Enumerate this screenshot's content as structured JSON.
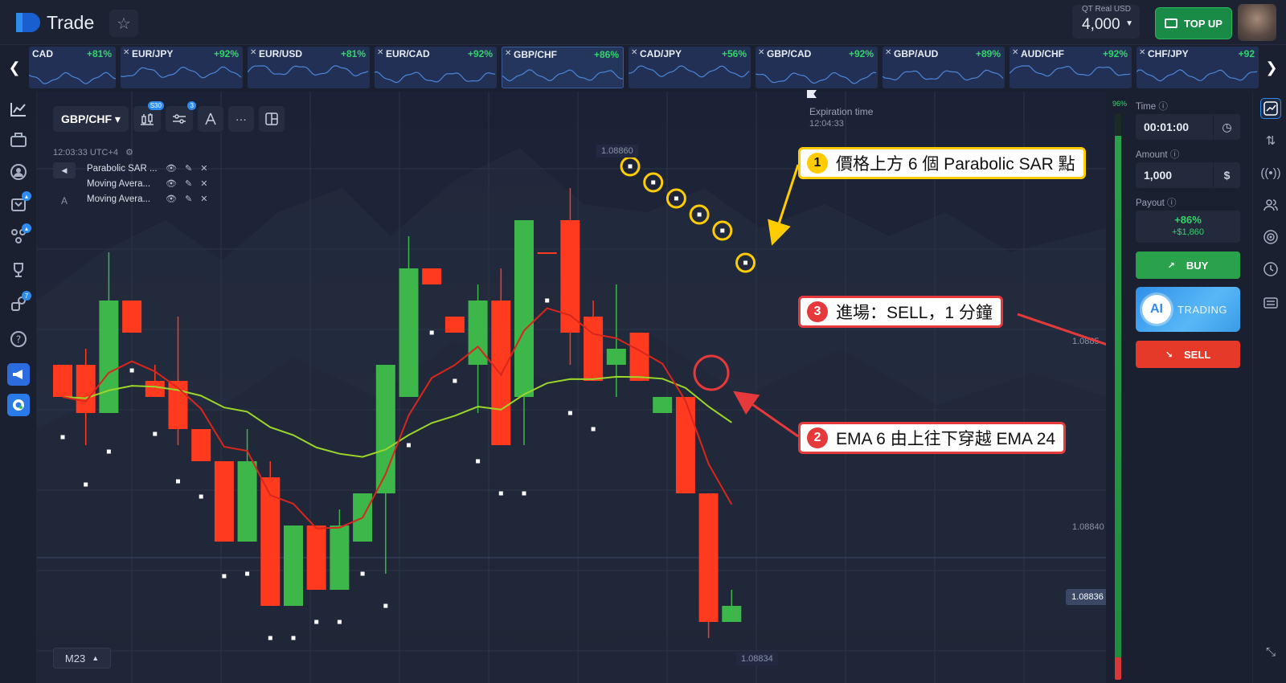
{
  "header": {
    "logo_text": "Trade",
    "account_label": "QT Real  USD",
    "account_value": "4,000",
    "topup_label": "TOP UP"
  },
  "pairs": [
    {
      "name": "CAD",
      "pct": "+81%"
    },
    {
      "name": "EUR/JPY",
      "pct": "+92%"
    },
    {
      "name": "EUR/USD",
      "pct": "+81%"
    },
    {
      "name": "EUR/CAD",
      "pct": "+92%"
    },
    {
      "name": "GBP/CHF",
      "pct": "+86%"
    },
    {
      "name": "CAD/JPY",
      "pct": "+56%"
    },
    {
      "name": "GBP/CAD",
      "pct": "+92%"
    },
    {
      "name": "GBP/AUD",
      "pct": "+89%"
    },
    {
      "name": "AUD/CHF",
      "pct": "+92%"
    },
    {
      "name": "CHF/JPY",
      "pct": "+92"
    }
  ],
  "sidebar_badges": {
    "bell": "",
    "gift": "",
    "group": "7"
  },
  "chart": {
    "pair": "GBP/CHF",
    "badge_candles": "S30",
    "badge_indicators": "3",
    "time_utc": "12:03:33 UTC+4",
    "indicators": [
      {
        "name": "Parabolic SAR ..."
      },
      {
        "name": "Moving Avera..."
      },
      {
        "name": "Moving Avera..."
      }
    ],
    "indicator_toggle_label": "A",
    "expiration_label": "Expiration time",
    "expiration_time": "12:04:33",
    "price_high": "1.08860",
    "price_mid": "1.0885",
    "price_low": "1.08840",
    "price_current": "1.08836",
    "price_min": "1.08834",
    "timeframe": "M23"
  },
  "chart_data": {
    "type": "candlestick",
    "candles": [
      {
        "dir": "down",
        "open": 1.08848,
        "close": 1.08846,
        "high": 1.08848,
        "low": 1.08846
      },
      {
        "dir": "down",
        "open": 1.08848,
        "close": 1.08845,
        "high": 1.08849,
        "low": 1.08843
      },
      {
        "dir": "up",
        "open": 1.08845,
        "close": 1.08852,
        "high": 1.08855,
        "low": 1.08845
      },
      {
        "dir": "down",
        "open": 1.08852,
        "close": 1.0885,
        "high": 1.08852,
        "low": 1.0885
      },
      {
        "dir": "down",
        "open": 1.08847,
        "close": 1.08846,
        "high": 1.08848,
        "low": 1.08846
      },
      {
        "dir": "down",
        "open": 1.08847,
        "close": 1.08844,
        "high": 1.08851,
        "low": 1.08843
      },
      {
        "dir": "down",
        "open": 1.08844,
        "close": 1.08842,
        "high": 1.08844,
        "low": 1.08842
      },
      {
        "dir": "down",
        "open": 1.08842,
        "close": 1.08837,
        "high": 1.08842,
        "low": 1.08837
      },
      {
        "dir": "up",
        "open": 1.08837,
        "close": 1.08842,
        "high": 1.08844,
        "low": 1.08837
      },
      {
        "dir": "down",
        "open": 1.08841,
        "close": 1.08833,
        "high": 1.08842,
        "low": 1.08833
      },
      {
        "dir": "up",
        "open": 1.08833,
        "close": 1.08838,
        "high": 1.08838,
        "low": 1.08833
      },
      {
        "dir": "down",
        "open": 1.08838,
        "close": 1.08834,
        "high": 1.08838,
        "low": 1.08834
      },
      {
        "dir": "up",
        "open": 1.08834,
        "close": 1.08838,
        "high": 1.08839,
        "low": 1.08834
      },
      {
        "dir": "up",
        "open": 1.08837,
        "close": 1.0884,
        "high": 1.0884,
        "low": 1.08837
      },
      {
        "dir": "up",
        "open": 1.0884,
        "close": 1.08848,
        "high": 1.08848,
        "low": 1.08835
      },
      {
        "dir": "up",
        "open": 1.08846,
        "close": 1.08854,
        "high": 1.08856,
        "low": 1.08846
      },
      {
        "dir": "down",
        "open": 1.08854,
        "close": 1.08853,
        "high": 1.08854,
        "low": 1.08853
      },
      {
        "dir": "down",
        "open": 1.08851,
        "close": 1.0885,
        "high": 1.08851,
        "low": 1.0885
      },
      {
        "dir": "up",
        "open": 1.08848,
        "close": 1.08852,
        "high": 1.08853,
        "low": 1.08845
      },
      {
        "dir": "down",
        "open": 1.08852,
        "close": 1.08843,
        "high": 1.08854,
        "low": 1.08843
      },
      {
        "dir": "up",
        "open": 1.08846,
        "close": 1.08857,
        "high": 1.08857,
        "low": 1.08843
      },
      {
        "dir": "down",
        "open": 1.08855,
        "close": 1.08855,
        "high": 1.08855,
        "low": 1.08855
      },
      {
        "dir": "down",
        "open": 1.08857,
        "close": 1.0885,
        "high": 1.08859,
        "low": 1.08848
      },
      {
        "dir": "down",
        "open": 1.08851,
        "close": 1.08847,
        "high": 1.08852,
        "low": 1.08847
      },
      {
        "dir": "up",
        "open": 1.08848,
        "close": 1.08849,
        "high": 1.08853,
        "low": 1.08846
      },
      {
        "dir": "down",
        "open": 1.0885,
        "close": 1.08847,
        "high": 1.0885,
        "low": 1.08847
      },
      {
        "dir": "up",
        "open": 1.08845,
        "close": 1.08846,
        "high": 1.08846,
        "low": 1.08845
      },
      {
        "dir": "down",
        "open": 1.08846,
        "close": 1.0884,
        "high": 1.08846,
        "low": 1.0884
      },
      {
        "dir": "down",
        "open": 1.0884,
        "close": 1.08832,
        "high": 1.0884,
        "low": 1.08831
      },
      {
        "dir": "up",
        "open": 1.08832,
        "close": 1.08833,
        "high": 1.08834,
        "low": 1.08832
      }
    ],
    "ylim": [
      1.0883,
      1.08862
    ],
    "grid": true
  },
  "annotations": {
    "a1": {
      "num": "1",
      "text": "價格上方 6 個 Parabolic SAR 點"
    },
    "a2": {
      "num": "2",
      "text": "EMA 6 由上往下穿越 EMA 24"
    },
    "a3": {
      "num": "3",
      "text": "進場：SELL，1 分鐘"
    }
  },
  "trade": {
    "progress_pct_label": "96%",
    "progress_value": 0.96,
    "time_label": "Time",
    "time_value": "00:01:00",
    "amount_label": "Amount",
    "amount_value": "1,000",
    "payout_label": "Payout",
    "payout_pct": "+86%",
    "payout_amount": "+$1,860",
    "buy_label": "BUY",
    "ai_label": "AI",
    "ai_trading": "TRADING",
    "sell_label": "SELL"
  },
  "colors": {
    "bull": "#3db64a",
    "bear": "#ff3a1f",
    "ema_fast": "#d9261c",
    "ema_slow": "#9bd62a",
    "annotation_yellow": "#ffcc00",
    "annotation_red": "#e5393b"
  }
}
